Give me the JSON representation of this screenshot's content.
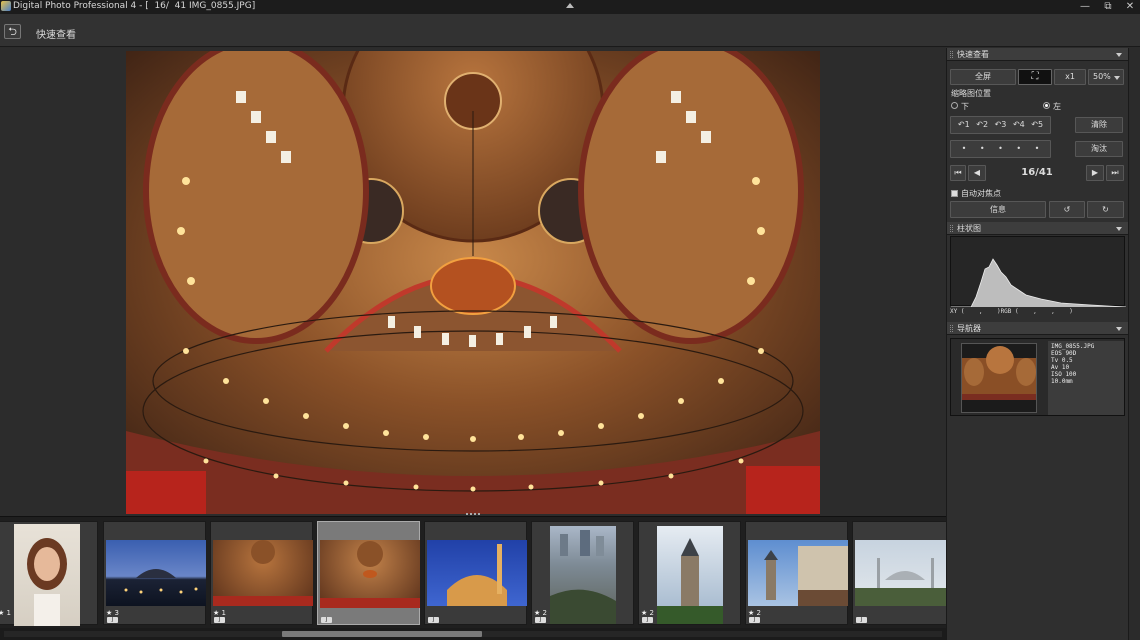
{
  "window": {
    "title": "Digital Photo Professional 4 - [  16/  41 IMG_0855.JPG]",
    "minimize": "—",
    "restore": "⧉",
    "close": "✕"
  },
  "toolbar": {
    "back_icon": "⮌",
    "title": "快速查看"
  },
  "panel": {
    "quickview": {
      "header": "快速查看",
      "fullscreen": "全屏",
      "fit_icon": "⛶",
      "x1": "x1",
      "zoom": "50%",
      "thumb_position_label": "缩略图位置",
      "pos_bottom": "下",
      "pos_left": "左",
      "ratings": [
        "↶1",
        "↶2",
        "↶3",
        "↶4",
        "↶5"
      ],
      "clear": "清除",
      "dots": [
        "•",
        "•",
        "•",
        "•",
        "•"
      ],
      "reject": "淘汰",
      "counter": "16/41",
      "auto_af": "自动对焦点",
      "info": "信息"
    },
    "histogram": {
      "header": "柱状图",
      "readout": "XY (    ,    )RGB (    ,    ,    )"
    },
    "navigator": {
      "header": "导航器",
      "info": [
        "IMG_0855.JPG",
        "EOS 90D",
        "Tv 0.5",
        "Av 10",
        "ISO 100",
        "10.0mm"
      ]
    }
  },
  "filmstrip": {
    "items": [
      {
        "rating": "★ 1",
        "tag": "J",
        "selected": false
      },
      {
        "rating": "★ 3",
        "tag": "J",
        "selected": false
      },
      {
        "rating": "★ 1",
        "tag": "J",
        "selected": false
      },
      {
        "rating": "",
        "tag": "J",
        "selected": true
      },
      {
        "rating": "",
        "tag": "J",
        "selected": false
      },
      {
        "rating": "★ 2",
        "tag": "J",
        "selected": false
      },
      {
        "rating": "★ 2",
        "tag": "J",
        "selected": false
      },
      {
        "rating": "★ 2",
        "tag": "J",
        "selected": false
      },
      {
        "rating": "",
        "tag": "J",
        "selected": false
      }
    ]
  }
}
